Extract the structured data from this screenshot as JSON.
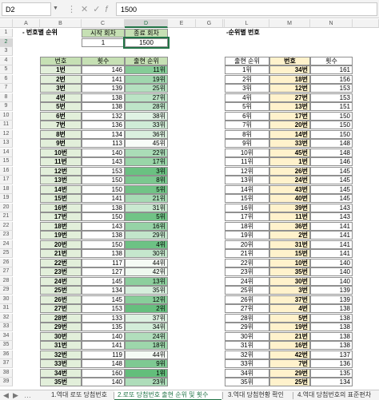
{
  "formula_bar": {
    "name_box": "D2",
    "formula": "1500",
    "icons": [
      "more-icon",
      "cancel-icon",
      "enter-icon",
      "fx-icon"
    ]
  },
  "columns": [
    "A",
    "B",
    "C",
    "D",
    "E",
    "F",
    "G",
    "H",
    "I",
    "J",
    "K",
    "L",
    "M",
    "N"
  ],
  "selected_column": "D",
  "rows": [
    "1",
    "2",
    "3",
    "4",
    "5",
    "6",
    "7",
    "8",
    "9",
    "10",
    "11",
    "12",
    "13",
    "14",
    "15",
    "16",
    "17",
    "18",
    "19",
    "20",
    "21",
    "22",
    "23",
    "24",
    "25",
    "26",
    "27",
    "28",
    "29",
    "30",
    "31",
    "32",
    "33",
    "34",
    "35",
    "36",
    "37",
    "38",
    "39",
    "40",
    "41",
    "42"
  ],
  "selected_row": "2",
  "section1": {
    "title": "- 번호별 순위",
    "start_label": "시작 회차",
    "end_label": "종료 회차",
    "start_value": "1",
    "end_value": "1500",
    "headers": [
      "번호",
      "횟수",
      "출현 순위"
    ]
  },
  "section2": {
    "title": "-순위별 번호",
    "headers": [
      "출현 순위",
      "번호",
      "횟수"
    ]
  },
  "table1": [
    {
      "num": "1번",
      "count": "146",
      "rank": "11위"
    },
    {
      "num": "2번",
      "count": "141",
      "rank": "19위"
    },
    {
      "num": "3번",
      "count": "139",
      "rank": "25위"
    },
    {
      "num": "4번",
      "count": "138",
      "rank": "27위"
    },
    {
      "num": "5번",
      "count": "138",
      "rank": "28위"
    },
    {
      "num": "6번",
      "count": "132",
      "rank": "38위"
    },
    {
      "num": "7번",
      "count": "136",
      "rank": "33위"
    },
    {
      "num": "8번",
      "count": "134",
      "rank": "36위"
    },
    {
      "num": "9번",
      "count": "113",
      "rank": "45위"
    },
    {
      "num": "10번",
      "count": "140",
      "rank": "22위"
    },
    {
      "num": "11번",
      "count": "143",
      "rank": "17위"
    },
    {
      "num": "12번",
      "count": "153",
      "rank": "3위"
    },
    {
      "num": "13번",
      "count": "150",
      "rank": "8위"
    },
    {
      "num": "14번",
      "count": "150",
      "rank": "5위"
    },
    {
      "num": "15번",
      "count": "141",
      "rank": "21위"
    },
    {
      "num": "16번",
      "count": "138",
      "rank": "31위"
    },
    {
      "num": "17번",
      "count": "150",
      "rank": "5위"
    },
    {
      "num": "18번",
      "count": "143",
      "rank": "16위"
    },
    {
      "num": "19번",
      "count": "138",
      "rank": "29위"
    },
    {
      "num": "20번",
      "count": "150",
      "rank": "4위"
    },
    {
      "num": "21번",
      "count": "138",
      "rank": "30위"
    },
    {
      "num": "22번",
      "count": "117",
      "rank": "44위"
    },
    {
      "num": "23번",
      "count": "127",
      "rank": "42위"
    },
    {
      "num": "24번",
      "count": "145",
      "rank": "13위"
    },
    {
      "num": "25번",
      "count": "134",
      "rank": "35위"
    },
    {
      "num": "26번",
      "count": "145",
      "rank": "12위"
    },
    {
      "num": "27번",
      "count": "153",
      "rank": "2위"
    },
    {
      "num": "28번",
      "count": "133",
      "rank": "37위"
    },
    {
      "num": "29번",
      "count": "135",
      "rank": "34위"
    },
    {
      "num": "30번",
      "count": "140",
      "rank": "24위"
    },
    {
      "num": "31번",
      "count": "141",
      "rank": "18위"
    },
    {
      "num": "32번",
      "count": "119",
      "rank": "44위"
    },
    {
      "num": "33번",
      "count": "148",
      "rank": "9위"
    },
    {
      "num": "34번",
      "count": "160",
      "rank": "1위"
    },
    {
      "num": "35번",
      "count": "140",
      "rank": "23위"
    }
  ],
  "table2": [
    {
      "rank": "1위",
      "num": "34번",
      "count": "161"
    },
    {
      "rank": "2위",
      "num": "18번",
      "count": "156"
    },
    {
      "rank": "3위",
      "num": "12번",
      "count": "153"
    },
    {
      "rank": "4위",
      "num": "27번",
      "count": "153"
    },
    {
      "rank": "5위",
      "num": "13번",
      "count": "151"
    },
    {
      "rank": "6위",
      "num": "17번",
      "count": "150"
    },
    {
      "rank": "7위",
      "num": "20번",
      "count": "150"
    },
    {
      "rank": "8위",
      "num": "14번",
      "count": "150"
    },
    {
      "rank": "9위",
      "num": "33번",
      "count": "148"
    },
    {
      "rank": "10위",
      "num": "45번",
      "count": "148"
    },
    {
      "rank": "11위",
      "num": "1번",
      "count": "146"
    },
    {
      "rank": "12위",
      "num": "26번",
      "count": "145"
    },
    {
      "rank": "13위",
      "num": "24번",
      "count": "145"
    },
    {
      "rank": "14위",
      "num": "43번",
      "count": "145"
    },
    {
      "rank": "15위",
      "num": "40번",
      "count": "145"
    },
    {
      "rank": "16위",
      "num": "39번",
      "count": "143"
    },
    {
      "rank": "17위",
      "num": "11번",
      "count": "143"
    },
    {
      "rank": "18위",
      "num": "36번",
      "count": "141"
    },
    {
      "rank": "19위",
      "num": "2번",
      "count": "141"
    },
    {
      "rank": "20위",
      "num": "31번",
      "count": "141"
    },
    {
      "rank": "21위",
      "num": "15번",
      "count": "141"
    },
    {
      "rank": "22위",
      "num": "10번",
      "count": "140"
    },
    {
      "rank": "23위",
      "num": "35번",
      "count": "140"
    },
    {
      "rank": "24위",
      "num": "30번",
      "count": "140"
    },
    {
      "rank": "25위",
      "num": "3번",
      "count": "139"
    },
    {
      "rank": "26위",
      "num": "37번",
      "count": "139"
    },
    {
      "rank": "27위",
      "num": "4번",
      "count": "138"
    },
    {
      "rank": "28위",
      "num": "5번",
      "count": "138"
    },
    {
      "rank": "29위",
      "num": "19번",
      "count": "138"
    },
    {
      "rank": "30위",
      "num": "21번",
      "count": "138"
    },
    {
      "rank": "31위",
      "num": "16번",
      "count": "138"
    },
    {
      "rank": "32위",
      "num": "42번",
      "count": "137"
    },
    {
      "rank": "33위",
      "num": "7번",
      "count": "136"
    },
    {
      "rank": "34위",
      "num": "29번",
      "count": "135"
    },
    {
      "rank": "35위",
      "num": "25번",
      "count": "134"
    }
  ],
  "sheet_tabs": [
    {
      "label": "1.역대 로또 당첨번호",
      "active": false
    },
    {
      "label": "2.로또 당첨번호 출현 순위 및 횟수",
      "active": true
    },
    {
      "label": "3.역대 당첨현황 확인",
      "active": false
    },
    {
      "label": "4.역대 당첨번호의 표준편차",
      "active": false
    }
  ],
  "colors": {
    "header_green": "#c6e0b4",
    "rank_green_light": "#e2efda",
    "rank_green_dark": "#63be7b",
    "number_yellow": "#fff2cc",
    "accent": "#217346"
  }
}
